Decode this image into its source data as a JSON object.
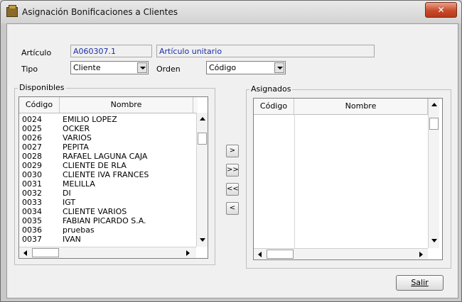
{
  "window": {
    "title": "Asignación Bonificaciones a Clientes",
    "close_label": "✕"
  },
  "form": {
    "articulo_label": "Artículo",
    "articulo_code": "A060307.1",
    "articulo_desc": "Artículo unitario",
    "tipo_label": "Tipo",
    "tipo_value": "Cliente",
    "orden_label": "Orden",
    "orden_value": "Código"
  },
  "disponibles": {
    "title": "Disponibles",
    "columns": [
      "Código",
      "Nombre"
    ],
    "rows": [
      {
        "codigo": "0024",
        "nombre": "EMILIO LOPEZ"
      },
      {
        "codigo": "0025",
        "nombre": "OCKER"
      },
      {
        "codigo": "0026",
        "nombre": "VARIOS"
      },
      {
        "codigo": "0027",
        "nombre": "PEPITA"
      },
      {
        "codigo": "0028",
        "nombre": "RAFAEL LAGUNA CAJA"
      },
      {
        "codigo": "0029",
        "nombre": "CLIENTE DE RLA"
      },
      {
        "codigo": "0030",
        "nombre": "CLIENTE IVA FRANCES"
      },
      {
        "codigo": "0031",
        "nombre": "MELILLA"
      },
      {
        "codigo": "0032",
        "nombre": "DI"
      },
      {
        "codigo": "0033",
        "nombre": "IGT"
      },
      {
        "codigo": "0034",
        "nombre": "CLIENTE VARIOS"
      },
      {
        "codigo": "0035",
        "nombre": "FABIAN PICARDO S.A."
      },
      {
        "codigo": "0036",
        "nombre": "pruebas"
      },
      {
        "codigo": "0037",
        "nombre": "IVAN"
      }
    ]
  },
  "asignados": {
    "title": "Asignados",
    "columns": [
      "Código",
      "Nombre"
    ],
    "rows": []
  },
  "transfer_buttons": [
    ">",
    ">>",
    "<<",
    "<"
  ],
  "exit_button": "Salir"
}
